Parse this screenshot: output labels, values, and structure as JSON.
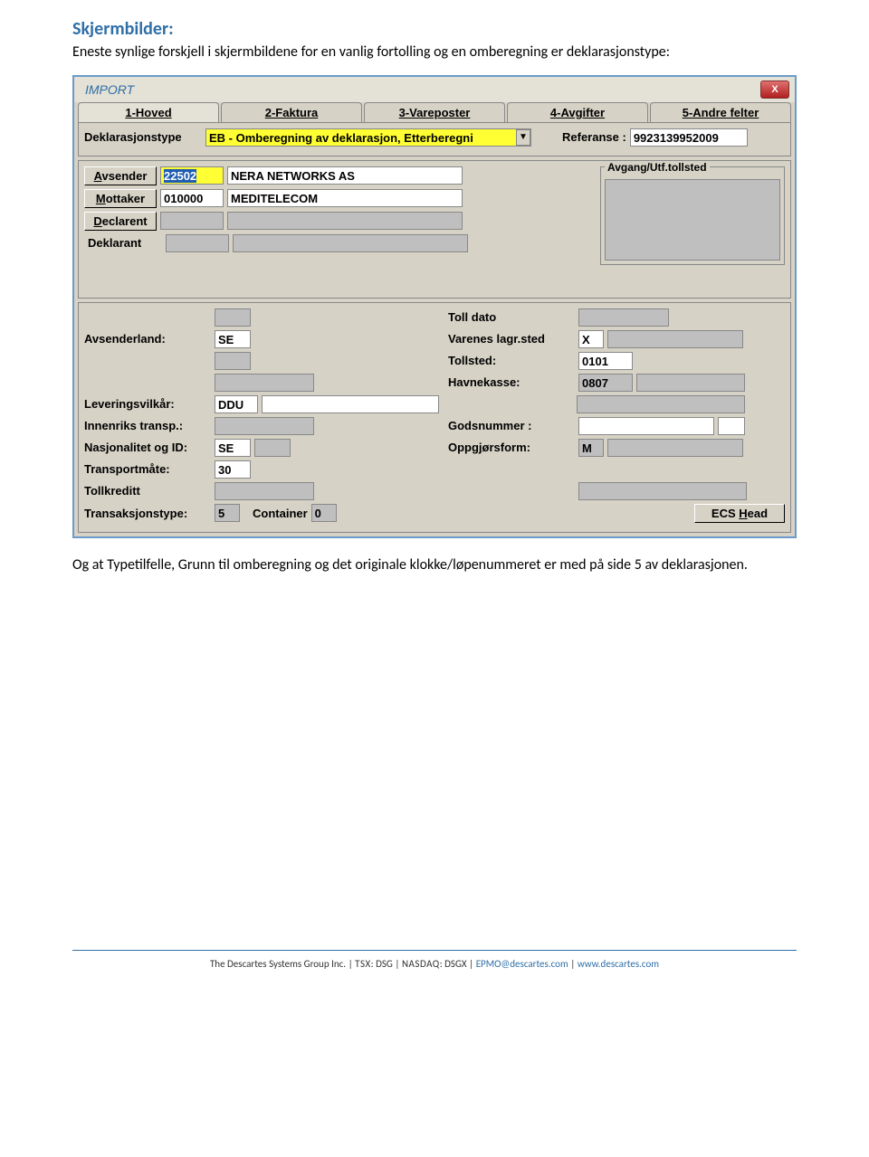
{
  "doc": {
    "heading": "Skjermbilder:",
    "intro1": "Eneste synlige forskjell i skjermbildene for en vanlig fortolling og en omberegning er deklarasjonstype:",
    "outro1": "Og at Typetilfelle, Grunn til omberegning og det originale klokke/løpenummeret er med på side 5 av deklarasjonen."
  },
  "win": {
    "title": "IMPORT",
    "close": "X",
    "tabs": {
      "t1": "1-Hoved",
      "t2": "2-Faktura",
      "t3": "3-Vareposter",
      "t4": "4-Avgifter",
      "t5": "5-Andre felter"
    },
    "dekl_label": "Deklarasjonstype",
    "dekl_value": "EB - Omberegning av deklarasjon, Etterberegni",
    "ref_label": "Referanse :",
    "ref_value": "9923139952009",
    "avgang_title": "Avgang/Utf.tollsted",
    "avsender_btn": "Avsender",
    "avsender_code": "22502",
    "avsender_name": "NERA NETWORKS AS",
    "mottaker_btn": "Mottaker",
    "mottaker_code": "010000",
    "mottaker_name": "MEDITELECOM",
    "declarent_btn": "Declarent",
    "deklarant_lbl": "Deklarant",
    "avsenderland_lbl": "Avsenderland:",
    "avsenderland_val": "SE",
    "tolldato_lbl": "Toll dato",
    "varenes_lbl": "Varenes lagr.sted",
    "varenes_val": "X",
    "tollsted_lbl": "Tollsted:",
    "tollsted_val": "0101",
    "havnekasse_lbl": "Havnekasse:",
    "havnekasse_val": "0807",
    "leverings_lbl": "Leveringsvilkår:",
    "leverings_val": "DDU",
    "innenriks_lbl": "Innenriks transp.:",
    "godsnr_lbl": "Godsnummer :",
    "nasj_lbl": "Nasjonalitet og ID:",
    "nasj_val": "SE",
    "oppgj_lbl": "Oppgjørsform:",
    "oppgj_val": "M",
    "transpm_lbl": "Transportmåte:",
    "transpm_val": "30",
    "tollkreditt_lbl": "Tollkreditt",
    "transaksj_lbl": "Transaksjonstype:",
    "transaksj_val": "5",
    "container_lbl": "Container",
    "container_val": "0",
    "ecs_btn": "ECS Head"
  },
  "footer": {
    "company": "The Descartes Systems Group Inc.",
    "tsx_lbl": "TSX",
    "tsx_val": ": DSG",
    "nasdaq_lbl": "NASDAQ",
    "nasdaq_val": ": DSGX",
    "email": "EPMO@descartes.com",
    "url": "www.descartes.com",
    "sep": " | "
  }
}
